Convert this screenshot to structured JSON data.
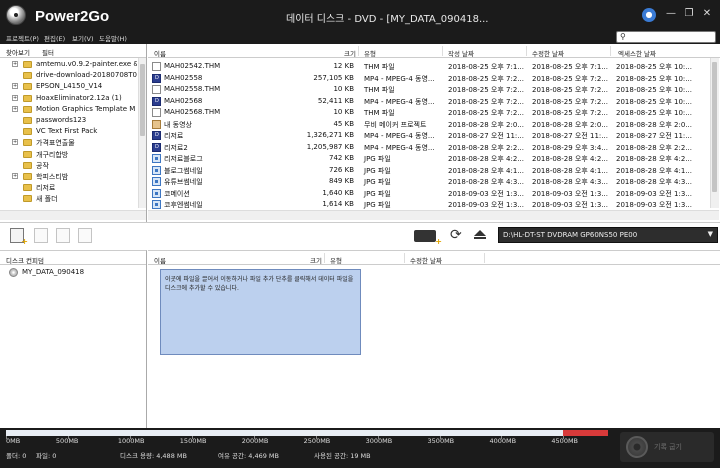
{
  "app": {
    "name": "Power2Go",
    "window_title": "데이터 디스크 - DVD - [MY_DATA_090418..."
  },
  "menu": [
    "프로젝트(P)",
    "편집(E)",
    "보기(V)",
    "도움말(H)"
  ],
  "search": {
    "placeholder": ""
  },
  "tree": {
    "tabs": [
      "찾아보기",
      "필터"
    ],
    "items": [
      {
        "label": "amtemu.v0.9.2-painter.exe &",
        "expandable": true
      },
      {
        "label": "drive-download-20180708T0",
        "expandable": false
      },
      {
        "label": "EPSON_L4150_V14",
        "expandable": true
      },
      {
        "label": "HoaxEliminator2.12a (1)",
        "expandable": true
      },
      {
        "label": "Motion Graphics Template M",
        "expandable": true
      },
      {
        "label": "passwords123",
        "expandable": false
      },
      {
        "label": "VC Text First Pack",
        "expandable": false
      },
      {
        "label": "가격표연출물",
        "expandable": true
      },
      {
        "label": "개구리합방",
        "expandable": false
      },
      {
        "label": "공작",
        "expandable": false
      },
      {
        "label": "학피스티밤",
        "expandable": true
      },
      {
        "label": "리저료",
        "expandable": false
      },
      {
        "label": "새 폴더",
        "expandable": false
      }
    ]
  },
  "files": {
    "columns": [
      "이름",
      "크기",
      "유형",
      "작성 날짜",
      "수정한 날짜",
      "엑세스한 날짜"
    ],
    "rows": [
      {
        "name": "MAH02542.THM",
        "size": "12 KB",
        "type": "THM 파일",
        "created": "2018-08-25 오후 7:1...",
        "modified": "2018-08-25 오후 7:1...",
        "accessed": "2018-08-25 오후 10:...",
        "icon": "doc"
      },
      {
        "name": "MAH02558",
        "size": "257,105 KB",
        "type": "MP4 - MPEG-4 동영...",
        "created": "2018-08-25 오후 7:2...",
        "modified": "2018-08-25 오후 7:2...",
        "accessed": "2018-08-25 오후 10:...",
        "icon": "video"
      },
      {
        "name": "MAH02558.THM",
        "size": "10 KB",
        "type": "THM 파일",
        "created": "2018-08-25 오후 7:2...",
        "modified": "2018-08-25 오후 7:2...",
        "accessed": "2018-08-25 오후 10:...",
        "icon": "doc"
      },
      {
        "name": "MAH02568",
        "size": "52,411 KB",
        "type": "MP4 - MPEG-4 동영...",
        "created": "2018-08-25 오후 7:2...",
        "modified": "2018-08-25 오후 7:2...",
        "accessed": "2018-08-25 오후 10:...",
        "icon": "video"
      },
      {
        "name": "MAH02568.THM",
        "size": "10 KB",
        "type": "THM 파일",
        "created": "2018-08-25 오후 7:2...",
        "modified": "2018-08-25 오후 7:2...",
        "accessed": "2018-08-25 오후 10:...",
        "icon": "doc"
      },
      {
        "name": "내 동영상",
        "size": "45 KB",
        "type": "무비 메이커 프로젝트",
        "created": "2018-08-28 오후 2:0...",
        "modified": "2018-08-28 오후 2:0...",
        "accessed": "2018-08-28 오후 2:0...",
        "icon": "proj"
      },
      {
        "name": "리저료",
        "size": "1,326,271 KB",
        "type": "MP4 - MPEG-4 동영...",
        "created": "2018-08-27 오전 11:...",
        "modified": "2018-08-27 오전 11:...",
        "accessed": "2018-08-27 오전 11:...",
        "icon": "video"
      },
      {
        "name": "리저료2",
        "size": "1,205,987 KB",
        "type": "MP4 - MPEG-4 동영...",
        "created": "2018-08-28 오후 2:2...",
        "modified": "2018-08-29 오후 3:4...",
        "accessed": "2018-08-28 오후 2:2...",
        "icon": "video"
      },
      {
        "name": "리저료블로그",
        "size": "742 KB",
        "type": "JPG 파일",
        "created": "2018-08-28 오후 4:2...",
        "modified": "2018-08-28 오후 4:2...",
        "accessed": "2018-08-28 오후 4:2...",
        "icon": "jpg"
      },
      {
        "name": "블로그썸네일",
        "size": "726 KB",
        "type": "JPG 파일",
        "created": "2018-08-28 오후 4:1...",
        "modified": "2018-08-28 오후 4:1...",
        "accessed": "2018-08-28 오후 4:1...",
        "icon": "jpg"
      },
      {
        "name": "유튜브썸네일",
        "size": "849 KB",
        "type": "JPG 파일",
        "created": "2018-08-28 오후 4:3...",
        "modified": "2018-08-28 오후 4:3...",
        "accessed": "2018-08-28 오후 4:3...",
        "icon": "jpg"
      },
      {
        "name": "코메이션",
        "size": "1,640 KB",
        "type": "JPG 파일",
        "created": "2018-09-03 오전 1:3...",
        "modified": "2018-09-03 오전 1:3...",
        "accessed": "2018-09-03 오전 1:3...",
        "icon": "jpg"
      },
      {
        "name": "코후엔썸네일",
        "size": "1,614 KB",
        "type": "JPG 파일",
        "created": "2018-09-03 오전 1:3...",
        "modified": "2018-09-03 오전 1:3...",
        "accessed": "2018-09-03 오전 1:3...",
        "icon": "jpg"
      }
    ]
  },
  "drive": {
    "selected": "D:\\HL-DT-ST DVDRAM GP60NS50 PE00"
  },
  "disc": {
    "header": "디스크 컨피덤",
    "item": "MY_DATA_090418",
    "columns": [
      "이름",
      "크기",
      "유형",
      "수정한 날짜"
    ],
    "hint": "이곳에 파일을 끌어서 이동하거나 파일 추가 단추를 클릭해서 데이터 파일을 디스크에 추가할 수 있습니다."
  },
  "capacity": {
    "ticks": [
      "0MB",
      "500MB",
      "1000MB",
      "1500MB",
      "2000MB",
      "2500MB",
      "3000MB",
      "3500MB",
      "4000MB",
      "4500MB"
    ],
    "used_fraction": 0.926,
    "over_fraction": 0.074,
    "colors": {
      "used": "#e9eef4",
      "over": "#d83a3a",
      "track": "#bdbdbd"
    }
  },
  "status": {
    "folders": "폴더: 0",
    "files": "파일: 0",
    "disc_capacity": "디스크 용량: 4,488 MB",
    "free_space": "여유 공간: 4,469 MB",
    "used_space": "사용된 공간: 19 MB"
  },
  "burn": {
    "label": "기록 굽기"
  }
}
